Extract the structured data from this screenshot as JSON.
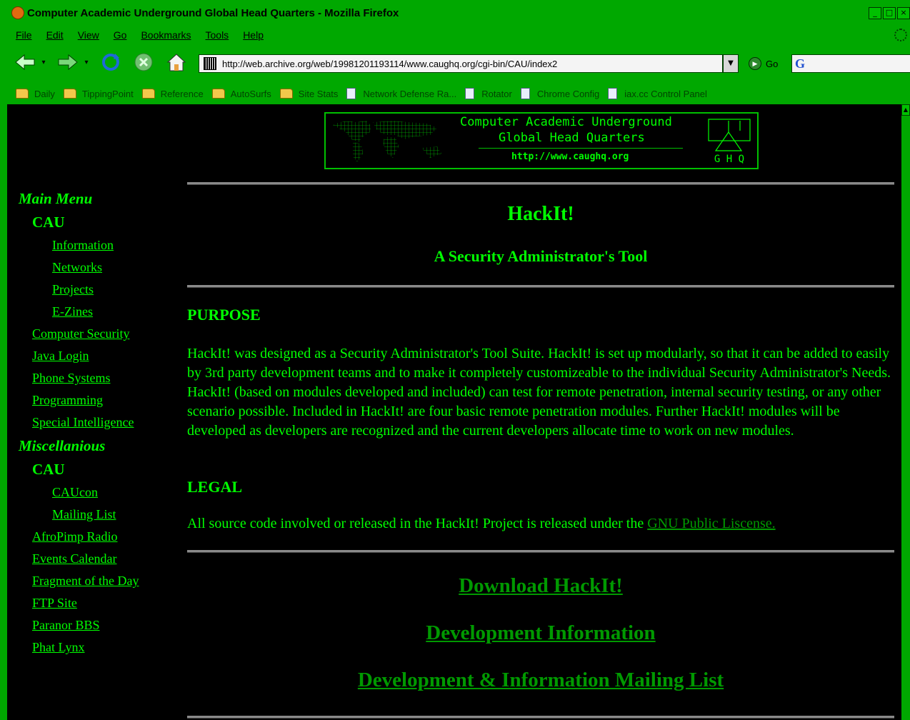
{
  "window": {
    "title": "Computer Academic Underground Global Head Quarters - Mozilla Firefox"
  },
  "menu": [
    "File",
    "Edit",
    "View",
    "Go",
    "Bookmarks",
    "Tools",
    "Help"
  ],
  "toolbar": {
    "url": "http://web.archive.org/web/19981201193114/www.caughq.org/cgi-bin/CAU/index2",
    "go_label": "Go",
    "search_engine_icon": "google-icon"
  },
  "bookmarks": [
    {
      "label": "Daily",
      "icon": "folder-icon"
    },
    {
      "label": "TippingPoint",
      "icon": "folder-icon"
    },
    {
      "label": "Reference",
      "icon": "folder-icon"
    },
    {
      "label": "AutoSurfs",
      "icon": "folder-icon"
    },
    {
      "label": "Site Stats",
      "icon": "folder-icon"
    },
    {
      "label": "Network Defense Ra...",
      "icon": "page-icon"
    },
    {
      "label": "Rotator",
      "icon": "page-icon"
    },
    {
      "label": "Chrome Config",
      "icon": "page-icon"
    },
    {
      "label": "iax.cc Control Panel",
      "icon": "page-icon"
    }
  ],
  "banner": {
    "line1": "Computer Academic Underground",
    "line2": "Global Head Quarters",
    "url": "http://www.caughq.org",
    "logo_text": "G H Q"
  },
  "nav": {
    "main_menu": "Main Menu",
    "cau": "CAU",
    "information": "Information",
    "networks": "Networks",
    "projects": "Projects",
    "ezines": "E-Zines",
    "computer_security": "Computer Security",
    "java_login": "Java Login",
    "phone_systems": "Phone Systems",
    "programming": "Programming",
    "special_intelligence": "Special Intelligence",
    "misc": "Miscellanious",
    "cau2": "CAU",
    "caucon": "CAUcon",
    "mailing_list": "Mailing List",
    "afropimp": "AfroPimp Radio",
    "events": "Events Calendar",
    "fragment": "Fragment of the Day",
    "ftp": "FTP Site",
    "paranor": "Paranor BBS",
    "phat": "Phat Lynx"
  },
  "main": {
    "title": "HackIt!",
    "subtitle": "A Security Administrator's Tool",
    "purpose_head": "PURPOSE",
    "purpose_text": "HackIt! was designed as a Security Administrator's Tool Suite. HackIt! is set up modularly, so that it can be added to easily by 3rd party development teams and to make it completely customizeable to the individual Security Administrator's Needs. HackIt! (based on modules developed and included) can test for remote penetration, internal security testing, or any other scenario possible. Included in HackIt! are four basic remote penetration modules. Further HackIt! modules will be developed as developers are recognized and the current developers allocate time to work on new modules.",
    "legal_head": "LEGAL",
    "legal_text": "All source code involved or released in the HackIt! Project is released under the ",
    "legal_link": "GNU Public Liscense.",
    "download": "Download HackIt!",
    "dev_info": "Development Information",
    "mailing": "Development & Information Mailing List"
  }
}
